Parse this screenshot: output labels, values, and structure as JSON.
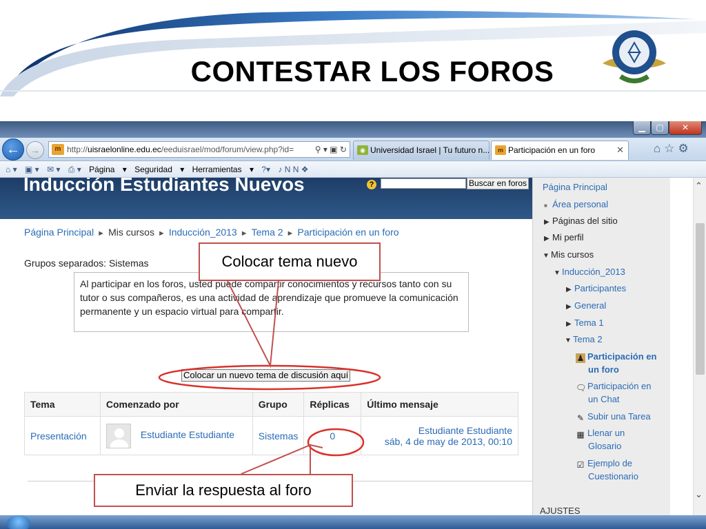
{
  "slide": {
    "title": "CONTESTAR LOS FOROS",
    "callout_top": "Colocar tema nuevo",
    "callout_bottom": "Enviar la respuesta al foro"
  },
  "browser": {
    "address_prefix": "http://",
    "address_domain": "uisraelonline.edu.ec",
    "address_path": "/eeduisrael/mod/forum/view.php?id=",
    "tabs": [
      {
        "label": "Universidad Israel | Tu futuro n..."
      },
      {
        "label": "Participación en un foro"
      }
    ],
    "command_bar": {
      "page": "Página",
      "security": "Seguridad",
      "tools": "Herramientas"
    }
  },
  "page": {
    "course_title": "Inducción Estudiantes Nuevos",
    "search_button": "Buscar en foros",
    "breadcrumb": [
      "Página Principal",
      "Mis cursos",
      "Inducción_2013",
      "Tema 2",
      "Participación en un foro"
    ],
    "groups_label": "Grupos separados: Sistemas",
    "intro_text": "Al participar en los foros, usted puede compartir conocimientos y recursos tanto con su tutor o sus compañeros, es una actividad de aprendizaje que promueve la comunicación permanente y un espacio virtual para compartir.",
    "new_topic_button": "Colocar un nuevo tema de discusión aquí",
    "table": {
      "headers": [
        "Tema",
        "Comenzado por",
        "Grupo",
        "Réplicas",
        "Último mensaje"
      ],
      "rows": [
        {
          "topic": "Presentación",
          "author": "Estudiante Estudiante",
          "group": "Sistemas",
          "replies": "0",
          "last_author": "Estudiante Estudiante",
          "last_date": "sáb, 4 de may de 2013, 00:10"
        }
      ]
    }
  },
  "sidebar": {
    "home": "Página Principal",
    "personal_area": "Área personal",
    "site_pages": "Páginas del sitio",
    "my_profile": "Mi perfil",
    "my_courses": "Mis cursos",
    "course": "Inducción_2013",
    "participants": "Participantes",
    "general": "General",
    "topic1": "Tema 1",
    "topic2": "Tema 2",
    "forum_line1": "Participación en",
    "forum_line2": "un foro",
    "chat_line1": "Participación en",
    "chat_line2": "un Chat",
    "task": "Subir una Tarea",
    "glossary_line1": "Llenar un",
    "glossary_line2": "Glosario",
    "quiz_line1": "Ejemplo de",
    "quiz_line2": "Cuestionario",
    "settings": "AJUSTES"
  }
}
